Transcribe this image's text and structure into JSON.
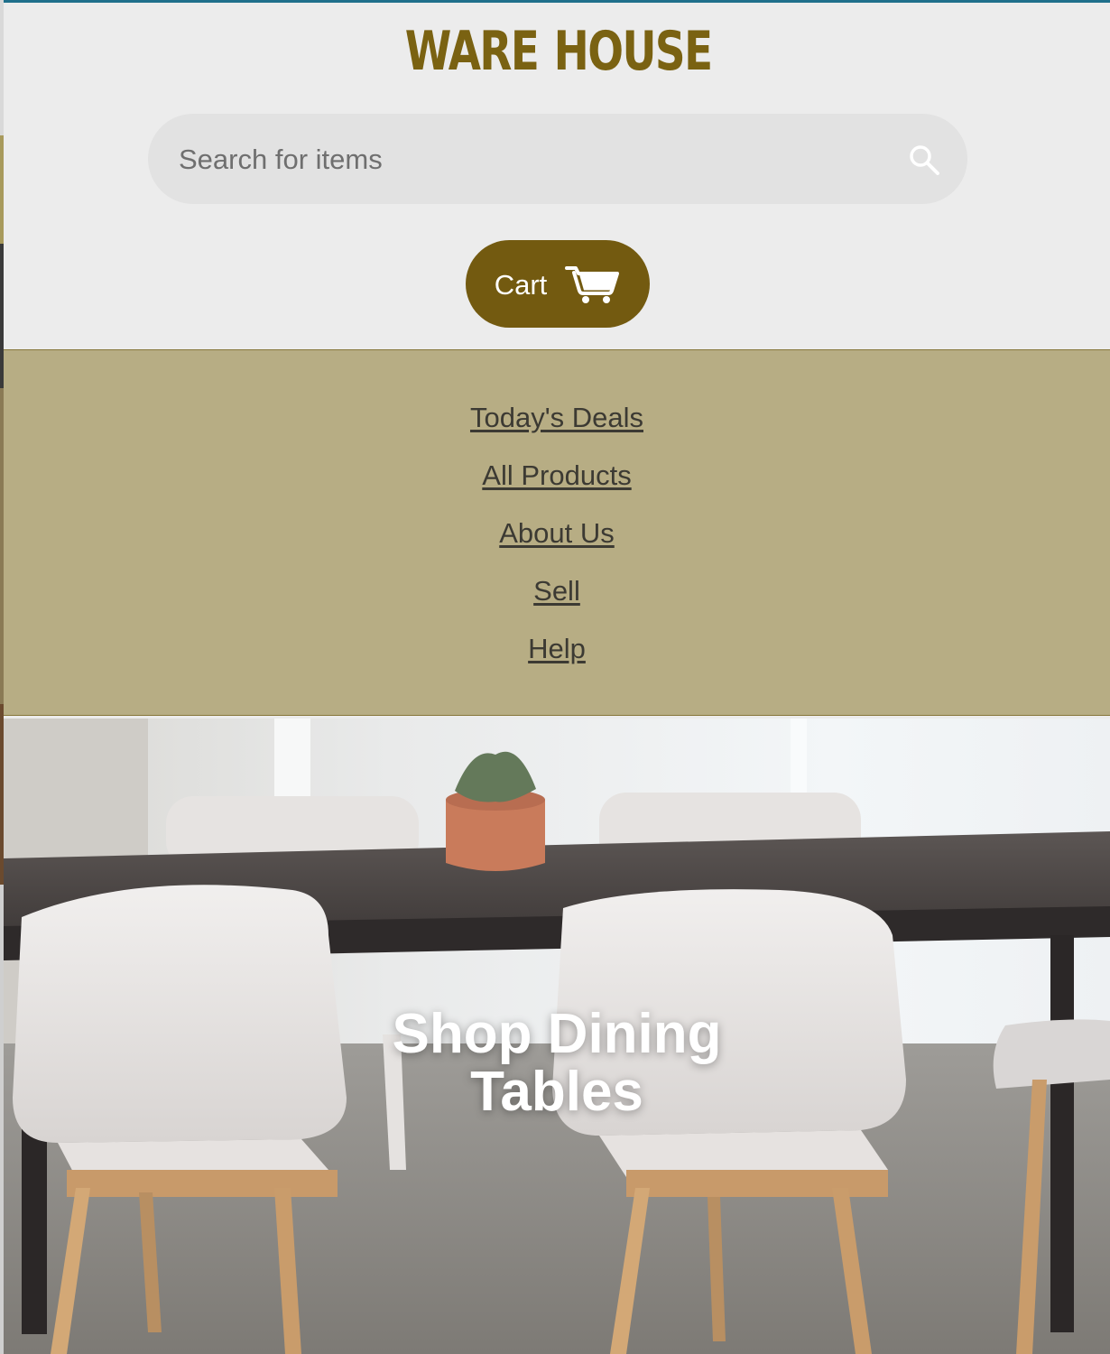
{
  "header": {
    "logo": {
      "word_left": "WARE",
      "word_right": "HOUSE",
      "icon": "house-icon"
    },
    "search": {
      "placeholder": "Search for items",
      "value": "",
      "icon": "search-icon"
    },
    "cart": {
      "label": "Cart",
      "icon": "cart-icon"
    }
  },
  "nav": {
    "items": [
      {
        "label": "Today's Deals"
      },
      {
        "label": "All Products"
      },
      {
        "label": "About Us"
      },
      {
        "label": "Sell"
      },
      {
        "label": "Help"
      }
    ]
  },
  "hero": {
    "title": "Shop Dining\nTables",
    "image": "dining-room-photo"
  },
  "colors": {
    "brand": "#735a10",
    "logo": "#7a6212",
    "header_bg": "#ececec",
    "search_bg": "#e2e2e2",
    "nav_bg": "#b7ad84",
    "nav_border": "#86763a",
    "nav_link": "#3c3a33",
    "top_line": "#1f6f8b"
  }
}
